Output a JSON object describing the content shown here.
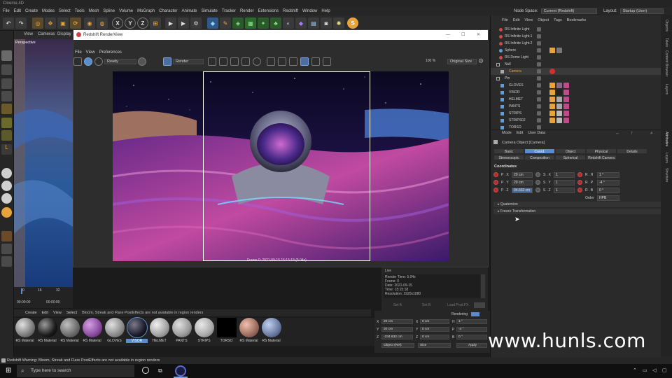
{
  "app": {
    "title": "Cinema 4D",
    "menu": [
      "File",
      "Edit",
      "Create",
      "Modes",
      "Select",
      "Tools",
      "Mesh",
      "Spline",
      "Volume",
      "MoGraph",
      "Character",
      "Animate",
      "Simulate",
      "Tracker",
      "Render",
      "Extensions",
      "Redshift",
      "Window",
      "Help"
    ],
    "node_space_label": "Node Space:",
    "node_space_value": "Current (Redshift)",
    "layout_label": "Layout:",
    "layout_value": "Startup (User)",
    "toolbar_letters": [
      "X",
      "Y",
      "Z"
    ]
  },
  "viewport": {
    "menu": [
      "View",
      "Cameras",
      "Display"
    ],
    "label": "Perspective"
  },
  "renderview": {
    "title": "Redshift RenderView",
    "menu": [
      "File",
      "View",
      "Preferences"
    ],
    "status": "Ready",
    "render_dropdown": "Render",
    "zoom": "100 %",
    "size_mode": "Original Size",
    "frame_caption": "Frame  0:  2021-09-15  15:15:18  (5.04s)"
  },
  "live_panel": {
    "label": "Live",
    "lines": [
      "Render Time: 5.04s",
      "Frame: 0",
      "Date: 2021-09-15",
      "Time: 15:15:18",
      "Resolution: 1920x1080"
    ],
    "buttons": [
      "Set A",
      "Set B",
      "Load Post FX"
    ]
  },
  "timeline": {
    "ticks": [
      "0",
      "16",
      "32"
    ],
    "time_start": "00:00:00",
    "time_end": "00:00:00"
  },
  "materials": {
    "menu": [
      "Create",
      "Edit",
      "View",
      "Select"
    ],
    "warning": "Bloom, Streak and Flare PostEffects are not available in region renders",
    "items": [
      {
        "label": "RS Material"
      },
      {
        "label": "RS Material"
      },
      {
        "label": "RS Material"
      },
      {
        "label": "RS Material"
      },
      {
        "label": "GLOVES"
      },
      {
        "label": "VISOR"
      },
      {
        "label": "HELMET"
      },
      {
        "label": "PANTS"
      },
      {
        "label": "STRIPS"
      },
      {
        "label": "TORSO"
      },
      {
        "label": "RS Material"
      },
      {
        "label": "RS Material"
      }
    ]
  },
  "coord_manager": {
    "rendering_label": "Rendering",
    "rows": [
      {
        "a": "X",
        "av": "20 cm",
        "b": "X",
        "bv": "0 cm",
        "c": "H",
        "cv": "1 °"
      },
      {
        "a": "Y",
        "av": "20 cm",
        "b": "Y",
        "bv": "0 cm",
        "c": "P",
        "cv": "-4 °"
      },
      {
        "a": "Z",
        "av": "-234.632 cm",
        "b": "Z",
        "bv": "0 cm",
        "c": "B",
        "cv": "0 °"
      }
    ],
    "mode": "Object (Rel)",
    "size": "Size",
    "apply": "Apply"
  },
  "object_manager": {
    "menu": [
      "File",
      "Edit",
      "View",
      "Object",
      "Tags",
      "Bookmarks"
    ],
    "objects": [
      {
        "name": "RS Infinite Light"
      },
      {
        "name": "RS Infinite Light.1"
      },
      {
        "name": "RS Infinite Light.2"
      },
      {
        "name": "Sphere"
      },
      {
        "name": "RS Dome Light"
      },
      {
        "name": "Null"
      },
      {
        "name": "Camera"
      },
      {
        "name": "Pin"
      },
      {
        "name": "GLOVES"
      },
      {
        "name": "VISOR"
      },
      {
        "name": "HELMET"
      },
      {
        "name": "PANTS"
      },
      {
        "name": "STRIPS"
      },
      {
        "name": "STRIPS02"
      },
      {
        "name": "TORSO"
      }
    ]
  },
  "attributes": {
    "menu": [
      "Mode",
      "Edit",
      "User Data"
    ],
    "object_title": "Camera Object [Camera]",
    "tabs_row1": [
      "Basic",
      "Coord.",
      "Object",
      "Physical",
      "Details"
    ],
    "tabs_row2": [
      "Stereoscopic",
      "Composition",
      "Spherical",
      "Redshift Camera"
    ],
    "active_tab": "Coord.",
    "section": "Coordinates",
    "fields": [
      {
        "p": "P . X",
        "pv": "20 cm",
        "s": "S . X",
        "sv": "1",
        "r": "R . H",
        "rv": "1 °"
      },
      {
        "p": "P . Y",
        "pv": "20 cm",
        "s": "S . Y",
        "sv": "1",
        "r": "R . P",
        "rv": "-4 °"
      },
      {
        "p": "P . Z",
        "pv": "34.632 cm",
        "s": "S . Z",
        "sv": "1",
        "r": "R . B",
        "rv": "0 °"
      }
    ],
    "order_label": "Order",
    "order_value": "HPB",
    "collapsed": [
      "Quaternion",
      "Freeze Transformation"
    ]
  },
  "side_tabs": [
    "Objects",
    "Takes",
    "Content Browser",
    "Layers",
    "Attributes",
    "Layers",
    "Structure"
  ],
  "statusbar": {
    "text": "Redshift Warning: Bloom, Streak and Flare PostEffects are not available in region renders"
  },
  "taskbar": {
    "search_placeholder": "Type here to search"
  },
  "watermark": "www.hunls.com",
  "colors": {
    "accent": "#5b8bc9",
    "red_dot": "#b03030",
    "select_orange": "#e8a43a"
  }
}
